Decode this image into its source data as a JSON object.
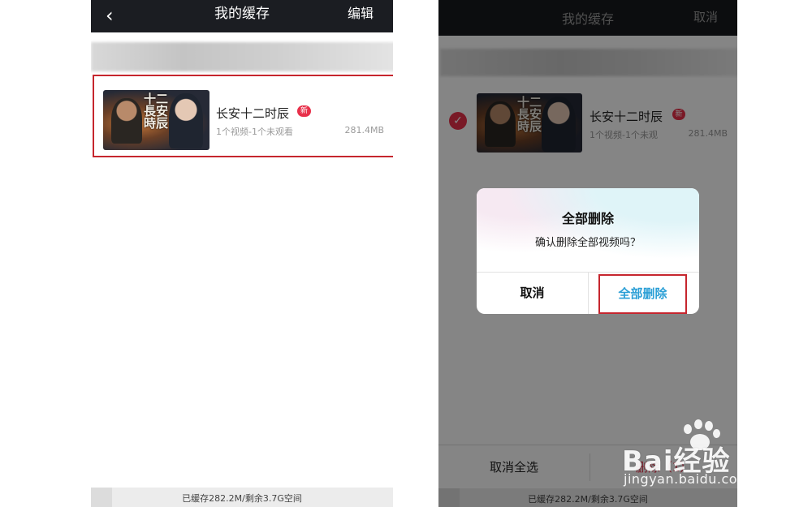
{
  "left_screen": {
    "nav": {
      "back_glyph": "‹",
      "title": "我的缓存",
      "edit_label": "编辑"
    },
    "item": {
      "thumbnail_text": "十二長安時辰",
      "title": "长安十二时辰",
      "badge": "新",
      "subtitle": "1个视频-1个未观看",
      "size": "281.4MB"
    },
    "footer": "已缓存282.2M/剩余3.7G空间"
  },
  "right_screen": {
    "nav": {
      "title": "我的缓存",
      "cancel_label": "取消"
    },
    "item": {
      "checked_glyph": "✓",
      "thumbnail_text": "十二長安時辰",
      "title": "长安十二时辰",
      "badge": "新",
      "subtitle": "1个视频-1个未观",
      "size": "281.4MB"
    },
    "bottom_bar": {
      "deselect_all": "取消全选",
      "delete": "删除（1）"
    },
    "footer": "已缓存282.2M/剩余3.7G空间",
    "dialog": {
      "title": "全部删除",
      "message": "确认删除全部视频吗？",
      "cancel": "取消",
      "confirm": "全部删除"
    }
  },
  "watermark": {
    "brand": "Bai经验",
    "url": "jingyan.baidu.com"
  },
  "colors": {
    "accent_red": "#e8304a",
    "link_blue": "#2b9fd6",
    "highlight_box": "#c6262e"
  }
}
